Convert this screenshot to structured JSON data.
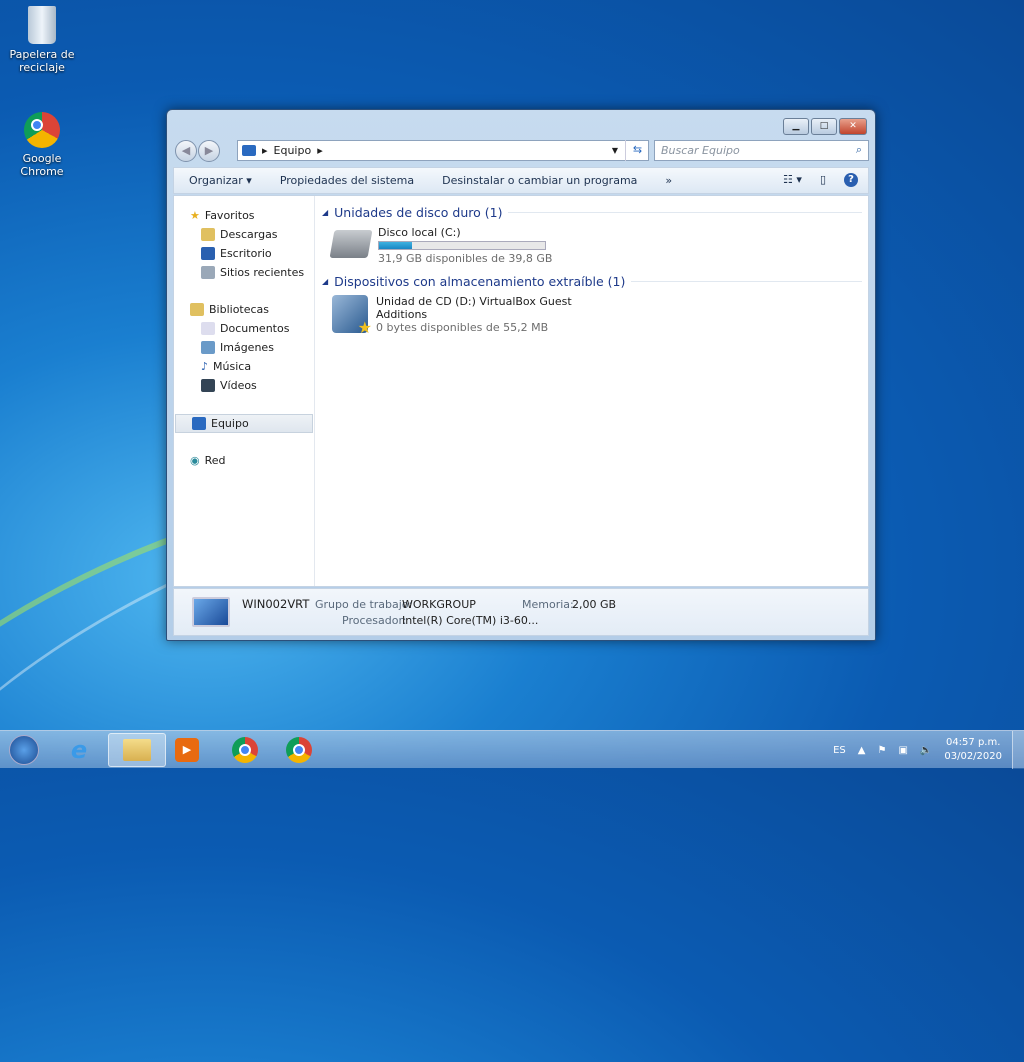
{
  "desktop": {
    "icons": [
      {
        "label": "Papelera de reciclaje"
      },
      {
        "label": "Google Chrome"
      }
    ]
  },
  "window": {
    "address": {
      "segments": [
        "Equipo"
      ]
    },
    "search_placeholder": "Buscar Equipo",
    "toolbar": {
      "organize": "Organizar",
      "system_properties": "Propiedades del sistema",
      "uninstall": "Desinstalar o cambiar un programa",
      "more": "»"
    },
    "sidebar": {
      "favorites": "Favoritos",
      "fav_items": [
        "Descargas",
        "Escritorio",
        "Sitios recientes"
      ],
      "libraries": "Bibliotecas",
      "lib_items": [
        "Documentos",
        "Imágenes",
        "Música",
        "Vídeos"
      ],
      "computer": "Equipo",
      "network": "Red"
    },
    "groups": [
      {
        "title": "Unidades de disco duro (1)",
        "items": [
          {
            "name": "Disco local (C:)",
            "free": "31,9 GB disponibles de 39,8 GB",
            "used_fraction": 0.2
          }
        ]
      },
      {
        "title": "Dispositivos con almacenamiento extraíble (1)",
        "items": [
          {
            "name": "Unidad de CD (D:) VirtualBox Guest",
            "name2": "Additions",
            "free": "0 bytes disponibles de 55,2 MB"
          }
        ]
      }
    ],
    "details": {
      "computer_name": "WIN002VRT",
      "workgroup_label": "Grupo de trabajo:",
      "workgroup": "WORKGROUP",
      "memory_label": "Memoria:",
      "memory": "2,00 GB",
      "processor_label": "Procesador:",
      "processor": "Intel(R) Core(TM) i3-60..."
    }
  },
  "taskbar": {
    "lang": "ES",
    "time": "04:57 p.m.",
    "date": "03/02/2020"
  }
}
